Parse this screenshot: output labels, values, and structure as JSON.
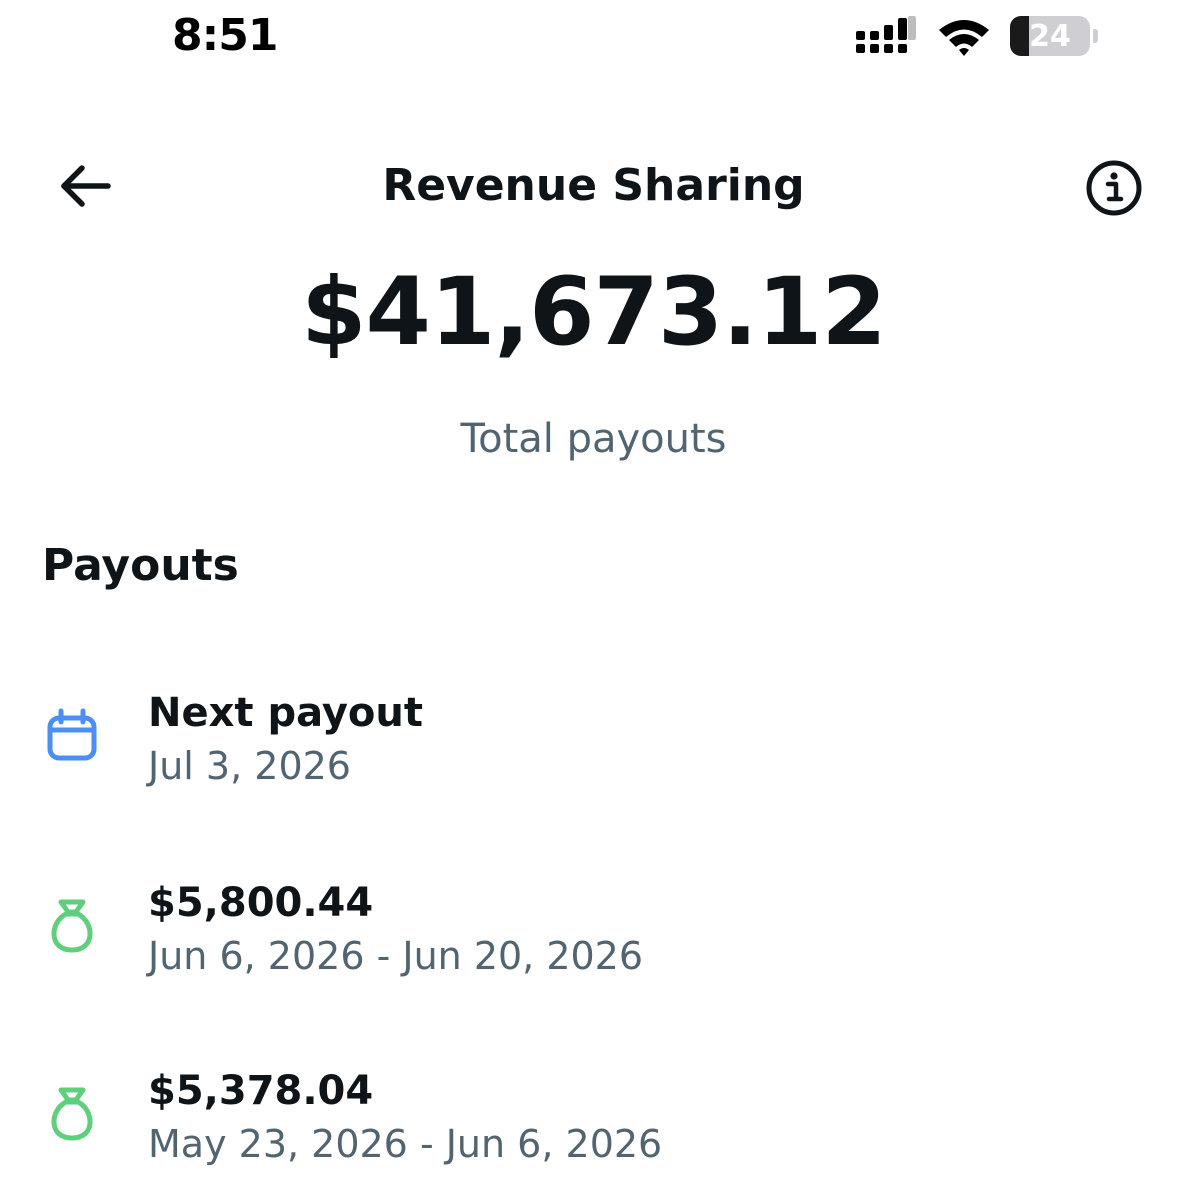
{
  "status_bar": {
    "time": "8:51",
    "battery_level": "24",
    "battery_fraction": 0.24
  },
  "header": {
    "title": "Revenue Sharing",
    "back_icon": "arrow-left-icon",
    "info_icon": "info-circle-icon"
  },
  "summary": {
    "total_amount": "$41,673.12",
    "total_label": "Total payouts"
  },
  "payouts": {
    "heading": "Payouts",
    "next": {
      "title": "Next payout",
      "date": "Jul 3, 2026",
      "icon": "calendar-icon"
    },
    "items": [
      {
        "amount": "$5,800.44",
        "period": "Jun 6, 2026 - Jun 20, 2026",
        "icon": "money-bag-icon"
      },
      {
        "amount": "$5,378.04",
        "period": "May 23, 2026 - Jun 6, 2026",
        "icon": "money-bag-icon"
      }
    ]
  },
  "colors": {
    "text_primary": "#0f1419",
    "text_secondary": "#536471",
    "calendar_blue": "#4c8ef5",
    "money_green": "#5fcf7e"
  }
}
